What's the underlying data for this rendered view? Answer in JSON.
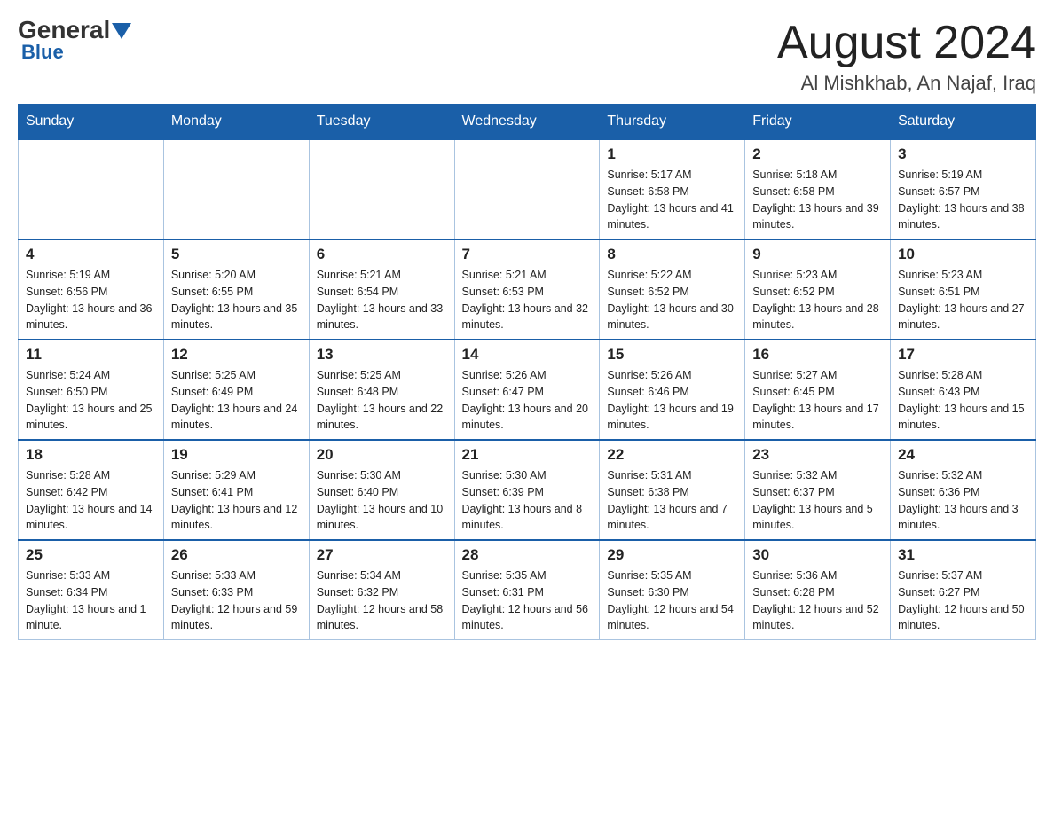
{
  "header": {
    "logo_main": "General",
    "logo_sub": "Blue",
    "month_title": "August 2024",
    "location": "Al Mishkhab, An Najaf, Iraq"
  },
  "weekdays": [
    "Sunday",
    "Monday",
    "Tuesday",
    "Wednesday",
    "Thursday",
    "Friday",
    "Saturday"
  ],
  "weeks": [
    [
      {
        "day": "",
        "info": ""
      },
      {
        "day": "",
        "info": ""
      },
      {
        "day": "",
        "info": ""
      },
      {
        "day": "",
        "info": ""
      },
      {
        "day": "1",
        "info": "Sunrise: 5:17 AM\nSunset: 6:58 PM\nDaylight: 13 hours and 41 minutes."
      },
      {
        "day": "2",
        "info": "Sunrise: 5:18 AM\nSunset: 6:58 PM\nDaylight: 13 hours and 39 minutes."
      },
      {
        "day": "3",
        "info": "Sunrise: 5:19 AM\nSunset: 6:57 PM\nDaylight: 13 hours and 38 minutes."
      }
    ],
    [
      {
        "day": "4",
        "info": "Sunrise: 5:19 AM\nSunset: 6:56 PM\nDaylight: 13 hours and 36 minutes."
      },
      {
        "day": "5",
        "info": "Sunrise: 5:20 AM\nSunset: 6:55 PM\nDaylight: 13 hours and 35 minutes."
      },
      {
        "day": "6",
        "info": "Sunrise: 5:21 AM\nSunset: 6:54 PM\nDaylight: 13 hours and 33 minutes."
      },
      {
        "day": "7",
        "info": "Sunrise: 5:21 AM\nSunset: 6:53 PM\nDaylight: 13 hours and 32 minutes."
      },
      {
        "day": "8",
        "info": "Sunrise: 5:22 AM\nSunset: 6:52 PM\nDaylight: 13 hours and 30 minutes."
      },
      {
        "day": "9",
        "info": "Sunrise: 5:23 AM\nSunset: 6:52 PM\nDaylight: 13 hours and 28 minutes."
      },
      {
        "day": "10",
        "info": "Sunrise: 5:23 AM\nSunset: 6:51 PM\nDaylight: 13 hours and 27 minutes."
      }
    ],
    [
      {
        "day": "11",
        "info": "Sunrise: 5:24 AM\nSunset: 6:50 PM\nDaylight: 13 hours and 25 minutes."
      },
      {
        "day": "12",
        "info": "Sunrise: 5:25 AM\nSunset: 6:49 PM\nDaylight: 13 hours and 24 minutes."
      },
      {
        "day": "13",
        "info": "Sunrise: 5:25 AM\nSunset: 6:48 PM\nDaylight: 13 hours and 22 minutes."
      },
      {
        "day": "14",
        "info": "Sunrise: 5:26 AM\nSunset: 6:47 PM\nDaylight: 13 hours and 20 minutes."
      },
      {
        "day": "15",
        "info": "Sunrise: 5:26 AM\nSunset: 6:46 PM\nDaylight: 13 hours and 19 minutes."
      },
      {
        "day": "16",
        "info": "Sunrise: 5:27 AM\nSunset: 6:45 PM\nDaylight: 13 hours and 17 minutes."
      },
      {
        "day": "17",
        "info": "Sunrise: 5:28 AM\nSunset: 6:43 PM\nDaylight: 13 hours and 15 minutes."
      }
    ],
    [
      {
        "day": "18",
        "info": "Sunrise: 5:28 AM\nSunset: 6:42 PM\nDaylight: 13 hours and 14 minutes."
      },
      {
        "day": "19",
        "info": "Sunrise: 5:29 AM\nSunset: 6:41 PM\nDaylight: 13 hours and 12 minutes."
      },
      {
        "day": "20",
        "info": "Sunrise: 5:30 AM\nSunset: 6:40 PM\nDaylight: 13 hours and 10 minutes."
      },
      {
        "day": "21",
        "info": "Sunrise: 5:30 AM\nSunset: 6:39 PM\nDaylight: 13 hours and 8 minutes."
      },
      {
        "day": "22",
        "info": "Sunrise: 5:31 AM\nSunset: 6:38 PM\nDaylight: 13 hours and 7 minutes."
      },
      {
        "day": "23",
        "info": "Sunrise: 5:32 AM\nSunset: 6:37 PM\nDaylight: 13 hours and 5 minutes."
      },
      {
        "day": "24",
        "info": "Sunrise: 5:32 AM\nSunset: 6:36 PM\nDaylight: 13 hours and 3 minutes."
      }
    ],
    [
      {
        "day": "25",
        "info": "Sunrise: 5:33 AM\nSunset: 6:34 PM\nDaylight: 13 hours and 1 minute."
      },
      {
        "day": "26",
        "info": "Sunrise: 5:33 AM\nSunset: 6:33 PM\nDaylight: 12 hours and 59 minutes."
      },
      {
        "day": "27",
        "info": "Sunrise: 5:34 AM\nSunset: 6:32 PM\nDaylight: 12 hours and 58 minutes."
      },
      {
        "day": "28",
        "info": "Sunrise: 5:35 AM\nSunset: 6:31 PM\nDaylight: 12 hours and 56 minutes."
      },
      {
        "day": "29",
        "info": "Sunrise: 5:35 AM\nSunset: 6:30 PM\nDaylight: 12 hours and 54 minutes."
      },
      {
        "day": "30",
        "info": "Sunrise: 5:36 AM\nSunset: 6:28 PM\nDaylight: 12 hours and 52 minutes."
      },
      {
        "day": "31",
        "info": "Sunrise: 5:37 AM\nSunset: 6:27 PM\nDaylight: 12 hours and 50 minutes."
      }
    ]
  ]
}
